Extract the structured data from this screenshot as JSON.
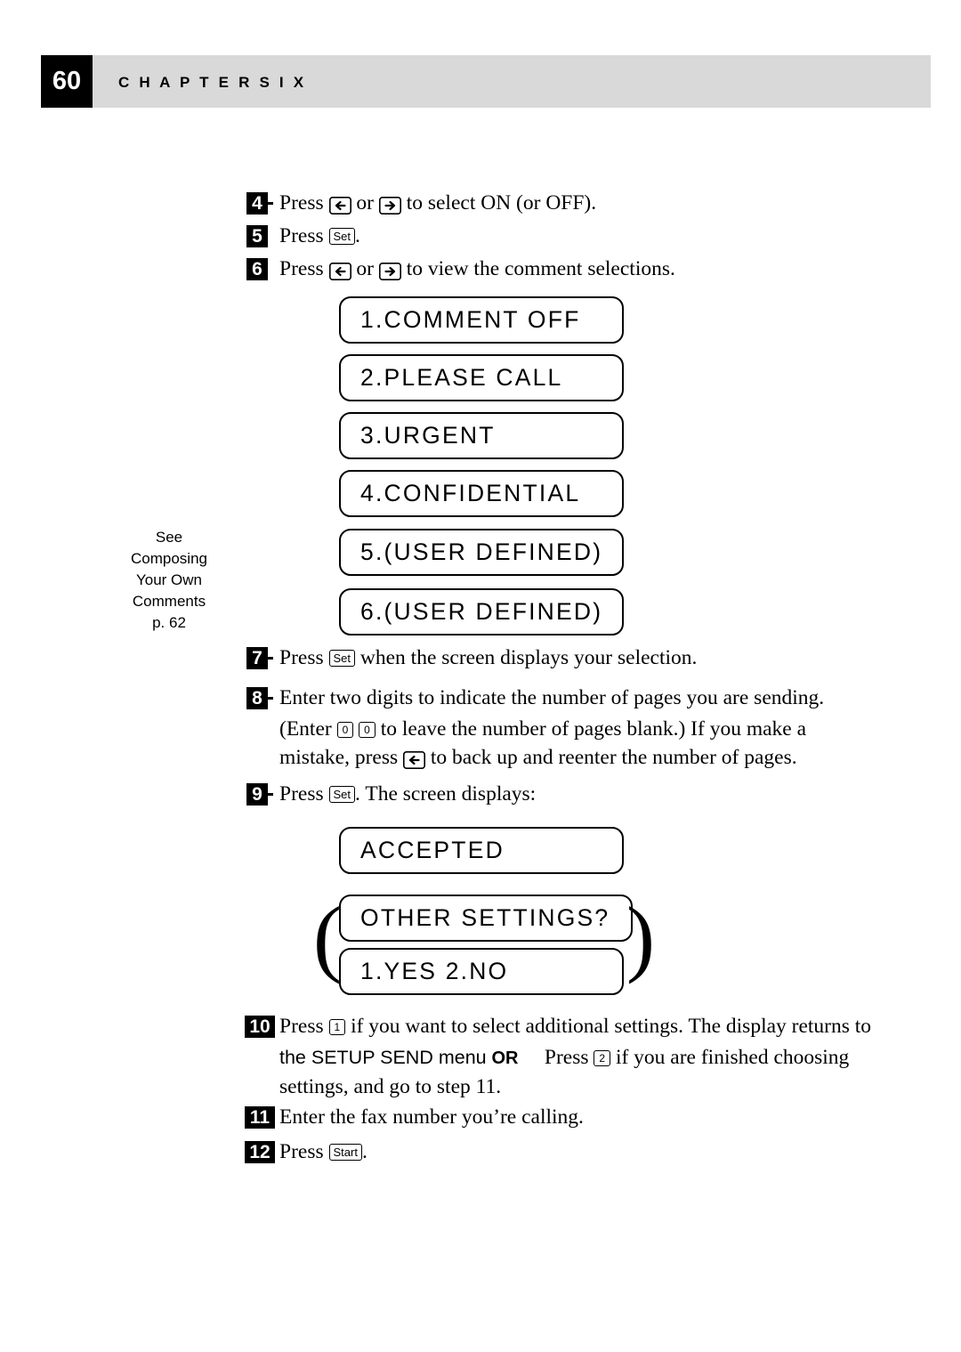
{
  "header": {
    "page_number": "60",
    "chapter_title": "C H A P T E R   S I X"
  },
  "steps": [
    {
      "num": "4",
      "text_before": "Press",
      "text_after": "to select ON (or OFF)."
    },
    {
      "num": "5",
      "text_before": "Press",
      "text_after": "."
    },
    {
      "num": "6",
      "text_before": "Press",
      "text_after": "to view the comment selections."
    },
    {
      "num": "7",
      "text_before": "Press",
      "text_after": "when the screen displays your selection."
    },
    {
      "num": "8",
      "text_before": "Enter two digits to indicate the number of pages you are sending.",
      "text_after": ""
    },
    {
      "num": "9",
      "text_before": "Press",
      "text_after": ". The screen displays:"
    },
    {
      "num": "10",
      "text_before": "Press",
      "text_after": "if you want to select additional settings. The display returns to"
    },
    {
      "num": "11",
      "text_before": "Enter the fax number you’re calling.",
      "text_after": ""
    },
    {
      "num": "12",
      "text_before": "Press",
      "text_after": "."
    }
  ],
  "text": {
    "step4_press": "Press",
    "step4_or": "or",
    "step4_tail": "to select ON (or OFF).",
    "step5_press": "Press",
    "step5_period": ".",
    "step6_press": "Press",
    "step6_or": "or",
    "step6_tail": "to view the comment selections.",
    "step7_press": "Press",
    "step7_tail": "when the screen displays your selection.",
    "step8_line1": "Enter two digits to indicate the number of pages you are sending.",
    "step8_line2a": "(Enter",
    "step8_line2b": "to leave the number of pages blank.) If you make a",
    "step8_line3a": "mistake, press",
    "step8_line3b": "to back up and reenter the number of pages.",
    "step9_press": "Press",
    "step9_tail": ". The screen displays:",
    "step10_press": "Press",
    "step10_tail": "if you want to select additional settings. The display returns to",
    "step10_line2a": "the SETUP SEND menu",
    "step10_or": "OR",
    "step10_line2b": "Press",
    "step10_line2c": "if you are finished choosing",
    "step10_line3": "settings, and go to step 11.",
    "step11": "Enter the fax number you’re calling.",
    "step12_press": "Press",
    "step12_period": "."
  },
  "keys": {
    "set": "Set",
    "start": "Start",
    "zero": "0",
    "one": "1",
    "two": "2"
  },
  "lcd_comment_list": [
    "1.COMMENT OFF",
    "2.PLEASE CALL",
    "3.URGENT",
    "4.CONFIDENTIAL",
    "5.(USER DEFINED)",
    "6.(USER DEFINED)"
  ],
  "lcd_accepted": [
    "ACCEPTED",
    "OTHER SETTINGS?",
    "1.YES 2.NO"
  ],
  "sidenote": {
    "line1": "See",
    "line2": "Composing",
    "line3": "Your Own",
    "line4": "Comments",
    "line5": "p. 62"
  }
}
